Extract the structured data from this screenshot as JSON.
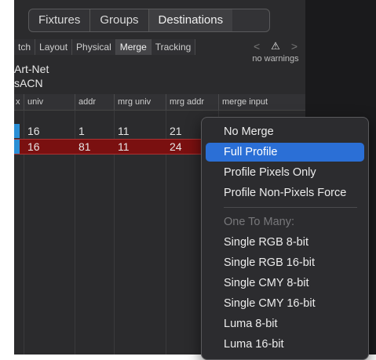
{
  "top_tabs": [
    "Fixtures",
    "Groups",
    "Destinations"
  ],
  "active_top_tab": "Destinations",
  "sub_tabs": [
    "tch",
    "Layout",
    "Physical",
    "Merge",
    "Tracking"
  ],
  "active_sub_tab": "Merge",
  "warnings": {
    "prev": "<",
    "icon": "⚠",
    "next": ">",
    "text": "no warnings"
  },
  "protocols": [
    "Art-Net",
    "sACN"
  ],
  "table": {
    "headers": [
      "x",
      "univ",
      "addr",
      "mrg univ",
      "mrg addr",
      "merge input"
    ],
    "rows": [
      {
        "univ": "16",
        "addr": "1",
        "mrg_univ": "11",
        "mrg_addr": "21"
      },
      {
        "univ": "16",
        "addr": "81",
        "mrg_univ": "11",
        "mrg_addr": "24"
      }
    ]
  },
  "menu": {
    "items": [
      "No Merge",
      "Full Profile",
      "Profile Pixels Only",
      "Profile Non-Pixels Force"
    ],
    "highlighted": "Full Profile",
    "section_label": "One To Many:",
    "section_items": [
      "Single RGB 8-bit",
      "Single RGB 16-bit",
      "Single CMY 8-bit",
      "Single CMY 16-bit",
      "Luma 8-bit",
      "Luma 16-bit"
    ]
  },
  "colors": {
    "selected_row": "#7a1010",
    "highlight": "#2b6fd6",
    "row_marker": "#2a8fd6"
  }
}
